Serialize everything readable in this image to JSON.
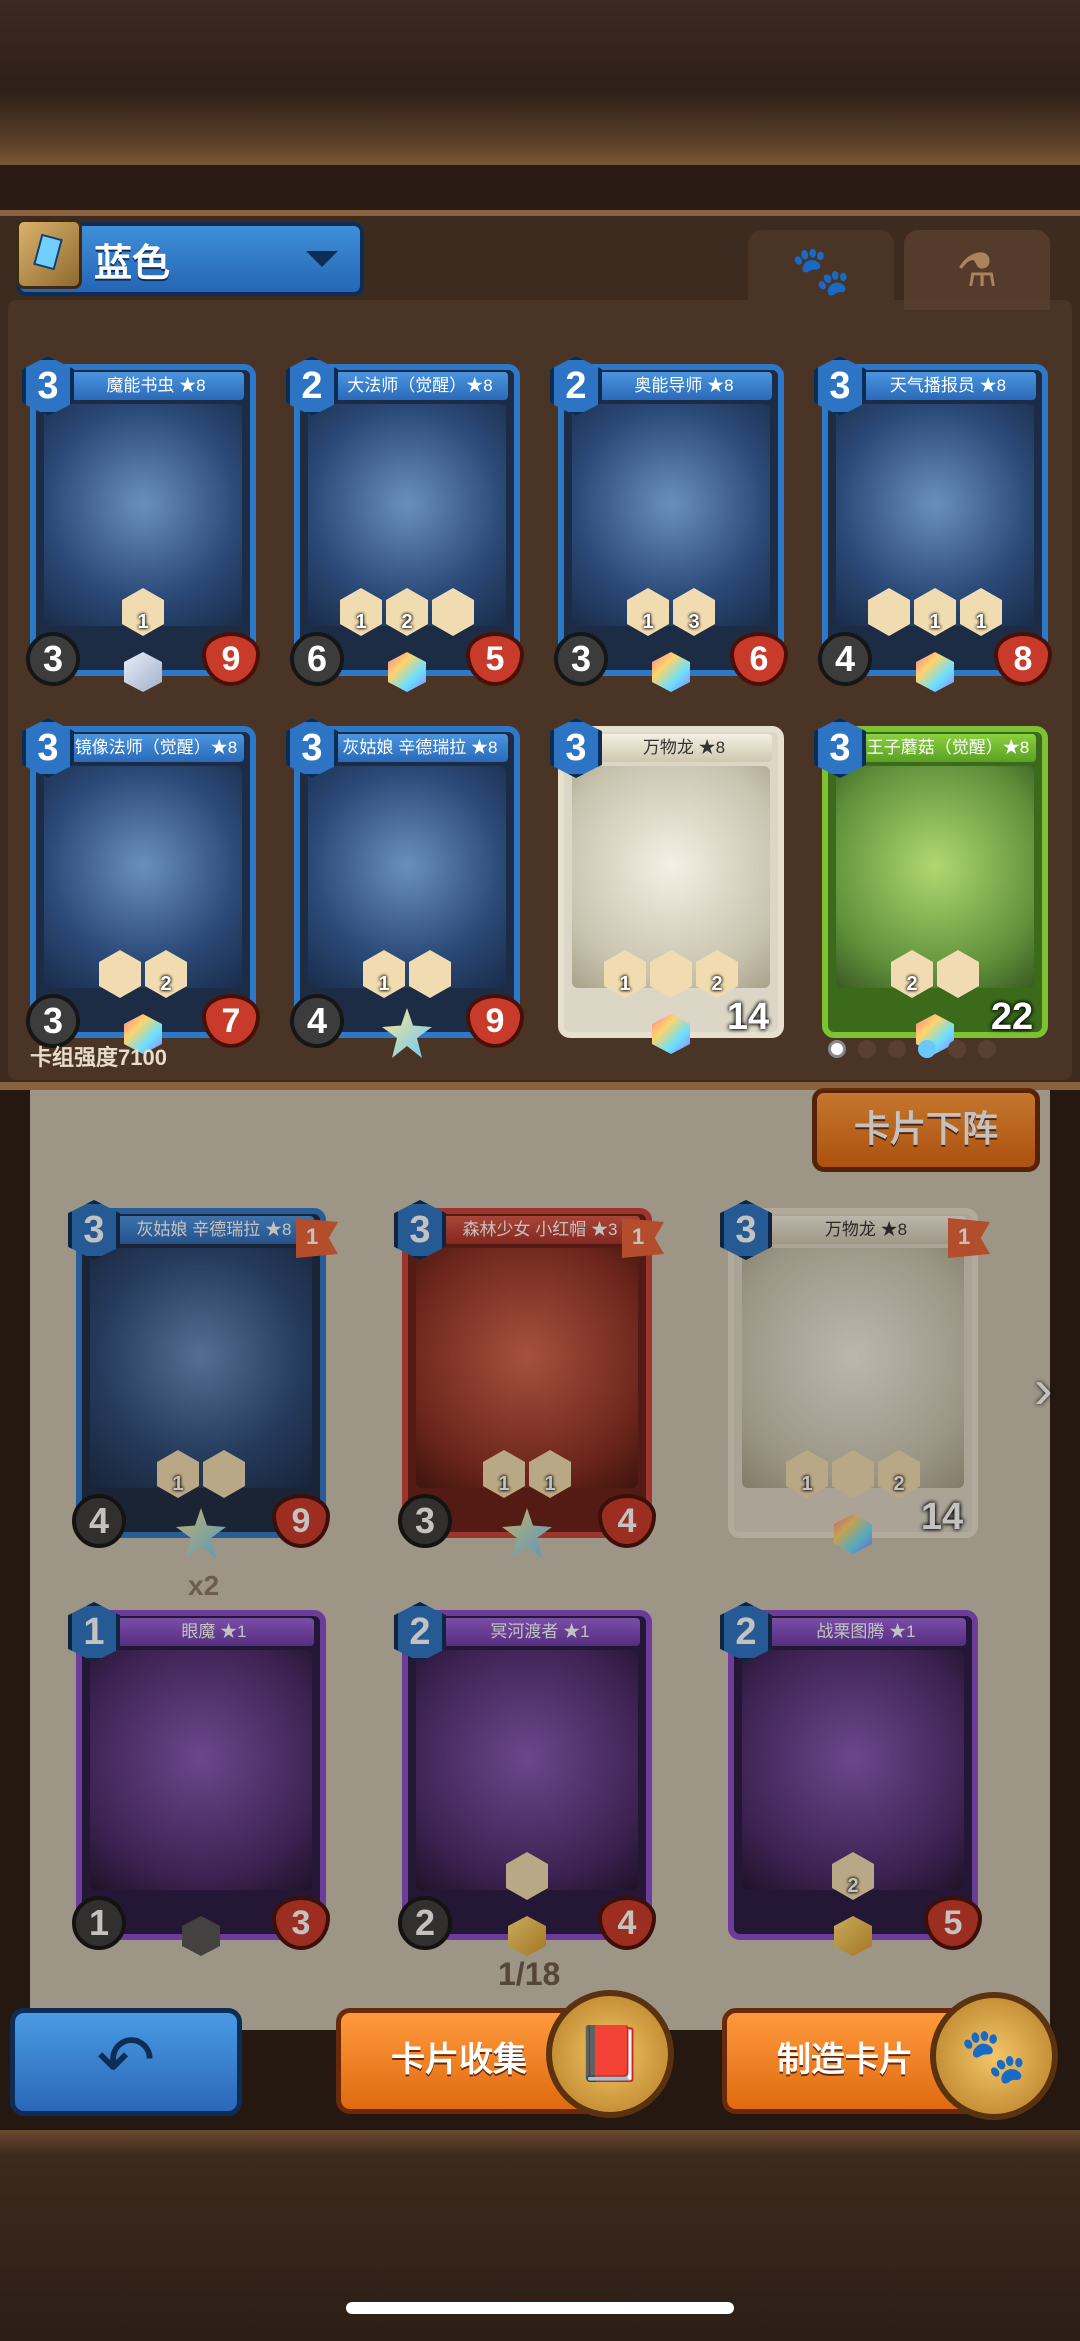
{
  "deck": {
    "name": "蓝色",
    "power_label": "卡组强度7100"
  },
  "tabs": {
    "creatures_icon": "paw-icon",
    "potions_icon": "flask-icon"
  },
  "deck_cards": [
    {
      "name": "魔能书虫 ★8",
      "cost": "3",
      "attack": "3",
      "health": "9",
      "skills": [
        "",
        "1",
        ""
      ],
      "frame": "blue"
    },
    {
      "name": "大法师（觉醒）★8",
      "cost": "2",
      "attack": "6",
      "health": "5",
      "skills": [
        "1",
        "2",
        ""
      ],
      "frame": "blue"
    },
    {
      "name": "奥能导师 ★8",
      "cost": "2",
      "attack": "3",
      "health": "6",
      "skills": [
        "1",
        "3",
        ""
      ],
      "frame": "blue"
    },
    {
      "name": "天气播报员 ★8",
      "cost": "3",
      "attack": "4",
      "health": "8",
      "skills": [
        "",
        "1",
        "1"
      ],
      "frame": "blue"
    },
    {
      "name": "镜像法师（觉醒）★8",
      "cost": "3",
      "attack": "3",
      "health": "7",
      "skills": [
        "",
        "2"
      ],
      "frame": "blue"
    },
    {
      "name": "灰姑娘 辛德瑞拉 ★8",
      "cost": "3",
      "attack": "4",
      "health": "9",
      "skills": [
        "1",
        ""
      ],
      "frame": "blue"
    },
    {
      "name": "万物龙 ★8",
      "cost": "3",
      "attack": "",
      "health": "14",
      "skills": [
        "1",
        "",
        "2"
      ],
      "frame": "white"
    },
    {
      "name": "王子蘑菇（觉醒）★8",
      "cost": "3",
      "attack": "",
      "health": "22",
      "skills": [
        "2",
        ""
      ],
      "frame": "green"
    }
  ],
  "unload_button": "卡片下阵",
  "collection_cards": [
    {
      "name": "灰姑娘 辛德瑞拉 ★8",
      "cost": "3",
      "attack": "4",
      "health": "9",
      "flag": "1",
      "skills": [
        "1",
        ""
      ],
      "frame": "blue"
    },
    {
      "name": "森林少女 小红帽 ★3",
      "cost": "3",
      "attack": "3",
      "health": "4",
      "flag": "1",
      "skills": [
        "1",
        "1"
      ],
      "frame": "red"
    },
    {
      "name": "万物龙 ★8",
      "cost": "3",
      "attack": "",
      "health": "14",
      "flag": "1",
      "skills": [
        "1",
        "",
        "2"
      ],
      "frame": "white"
    },
    {
      "name": "眼魔 ★1",
      "cost": "1",
      "attack": "1",
      "health": "3",
      "flag": "",
      "skills": [],
      "frame": "purple"
    },
    {
      "name": "冥河渡者 ★1",
      "cost": "2",
      "attack": "2",
      "health": "4",
      "flag": "",
      "skills": [
        ""
      ],
      "frame": "purple"
    },
    {
      "name": "战栗图腾 ★1",
      "cost": "2",
      "attack": "",
      "health": "5",
      "flag": "",
      "skills": [
        "2"
      ],
      "frame": "purple"
    }
  ],
  "copies_label": "x2",
  "page_indicator": "1/18",
  "buttons": {
    "back_icon": "back-arrow-icon",
    "collect_label": "卡片收集",
    "craft_label": "制造卡片"
  }
}
